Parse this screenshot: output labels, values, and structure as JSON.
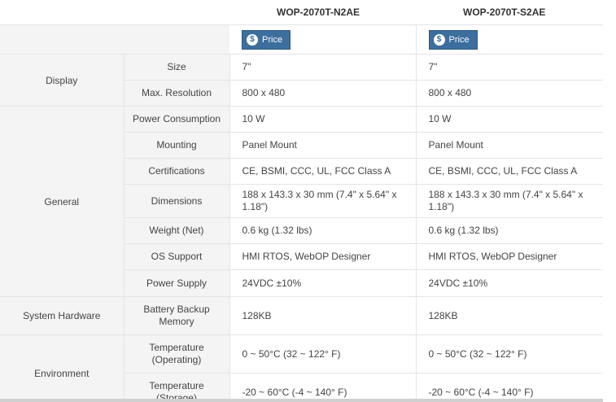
{
  "products": [
    "WOP-2070T-N2AE",
    "WOP-2070T-S2AE"
  ],
  "price_label": "Price",
  "price_icon": "dollar-icon",
  "colors": {
    "price_button": "#3c6e9e",
    "label_bg": "#f4f4f4"
  },
  "groups": {
    "display": "Display",
    "general": "General",
    "system_hardware": "System Hardware",
    "environment": "Environment"
  },
  "rows": {
    "size": {
      "label": "Size",
      "values": [
        "7\"",
        "7\""
      ]
    },
    "max_resolution": {
      "label": "Max. Resolution",
      "values": [
        "800 x 480",
        "800 x 480"
      ]
    },
    "power_consumption": {
      "label": "Power Consumption",
      "values": [
        "10 W",
        "10 W"
      ]
    },
    "mounting": {
      "label": "Mounting",
      "values": [
        "Panel Mount",
        "Panel Mount"
      ]
    },
    "certifications": {
      "label": "Certifications",
      "values": [
        "CE, BSMI, CCC, UL, FCC Class A",
        "CE, BSMI, CCC, UL, FCC Class A"
      ]
    },
    "dimensions": {
      "label": "Dimensions",
      "values": [
        "188 x 143.3 x 30 mm (7.4\" x 5.64\" x 1.18\")",
        "188 x 143.3 x 30 mm (7.4\" x 5.64\" x 1.18\")"
      ]
    },
    "weight": {
      "label": "Weight (Net)",
      "values": [
        "0.6 kg (1.32 lbs)",
        "0.6 kg (1.32 lbs)"
      ]
    },
    "os_support": {
      "label": "OS Support",
      "values": [
        "HMI RTOS, WebOP Designer",
        "HMI RTOS, WebOP Designer"
      ]
    },
    "power_supply": {
      "label": "Power Supply",
      "values": [
        "24VDC ±10%",
        "24VDC ±10%"
      ]
    },
    "battery_backup_memory": {
      "label": "Battery Backup Memory",
      "values": [
        "128KB",
        "128KB"
      ]
    },
    "temp_operating": {
      "label": "Temperature (Operating)",
      "values": [
        "0 ~ 50°C (32 ~ 122° F)",
        "0 ~ 50°C (32 ~ 122° F)"
      ]
    },
    "temp_storage": {
      "label": "Temperature (Storage)",
      "values": [
        "-20 ~ 60°C (-4 ~ 140° F)",
        "-20 ~ 60°C (-4 ~ 140° F)"
      ]
    }
  }
}
